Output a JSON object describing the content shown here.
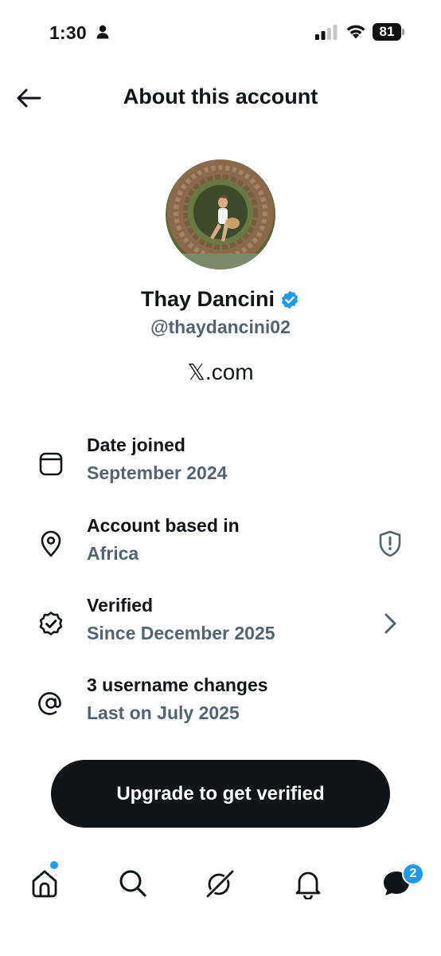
{
  "status_bar": {
    "time": "1:30",
    "battery": "81"
  },
  "header": {
    "title": "About this account"
  },
  "profile": {
    "name": "Thay Dancini",
    "handle": "@thaydancini02",
    "site": "𝕏.com"
  },
  "info": [
    {
      "title": "Date joined",
      "subtitle": "September 2024",
      "icon": "calendar-icon"
    },
    {
      "title": "Account based in",
      "subtitle": "Africa",
      "icon": "location-pin-icon",
      "trailing": "shield-alert-icon"
    },
    {
      "title": "Verified",
      "subtitle": "Since December 2025",
      "icon": "verified-badge-icon",
      "trailing": "chevron-right-icon"
    },
    {
      "title": "3 username changes",
      "subtitle": "Last on July 2025",
      "icon": "at-sign-icon"
    }
  ],
  "upgrade_button": "Upgrade to get verified",
  "tab_bar": {
    "tabs": [
      "home",
      "search",
      "grok",
      "notifications",
      "messages"
    ],
    "messages_badge": "2"
  },
  "colors": {
    "primary_text": "#0f1419",
    "secondary_text": "#536471",
    "accent": "#1d9bf0"
  }
}
